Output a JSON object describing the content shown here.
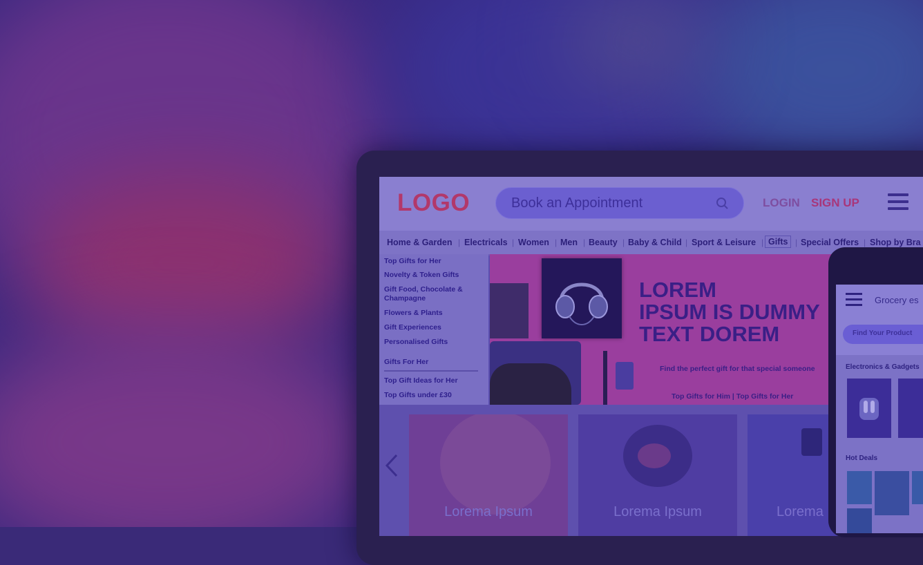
{
  "header": {
    "logo": "LOGO",
    "search_placeholder": "Book an Appointment",
    "login": "LOGIN",
    "sign_up": "SIGN UP"
  },
  "categories": [
    "Home & Garden",
    "Electricals",
    "Women",
    "Men",
    "Beauty",
    "Baby & Child",
    "Sport & Leisure",
    "Gifts",
    "Special Offers",
    "Shop by Bra"
  ],
  "active_category": "Gifts",
  "sidebar": {
    "items": [
      "Top Gifts for Her",
      "Novelty & Token Gifts",
      "Gift Food, Chocolate & Champagne",
      "Flowers & Plants",
      "Gift Experiences",
      "Personalised Gifts"
    ],
    "heading": "Gifts For Her",
    "items2": [
      "Top Gift Ideas for Her",
      "Top Gifts under £30"
    ]
  },
  "banner": {
    "title_line1": "LOREM",
    "title_line2": "IPSUM IS DUMMY",
    "title_line3": "TEXT DOREM",
    "subtitle": "Find the perfect gift for that special someone",
    "links": "Top Gifts for Him | Top Gifts for Her"
  },
  "carousel": {
    "cards": [
      "Lorema Ipsum",
      "Lorema Ipsum",
      "Lorema"
    ]
  },
  "phone": {
    "title": "Grocery es",
    "find_button": "Find Your Product",
    "section1": "Electronics & Gadgets",
    "section2": "Hot Deals"
  },
  "colors": {
    "logo": "#b2386a",
    "sign_up": "#a8367a",
    "overlay": "#34268c"
  }
}
